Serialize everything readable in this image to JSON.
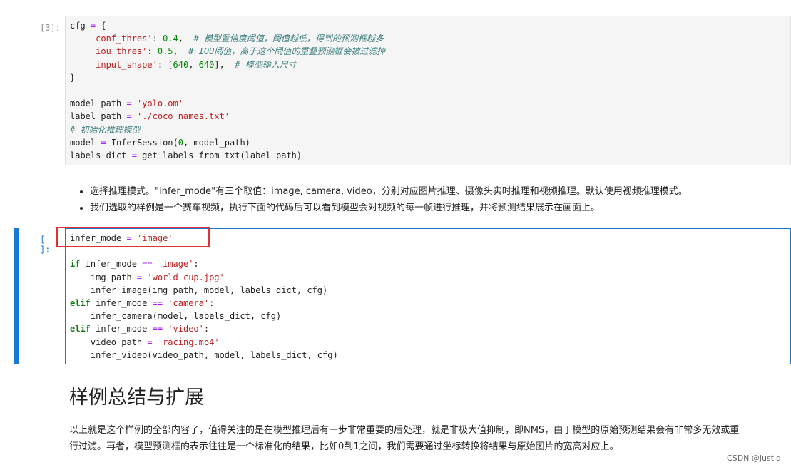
{
  "cell1": {
    "prompt": "[3]:",
    "lines": [
      [
        [
          "p",
          "cfg "
        ],
        [
          "o",
          "="
        ],
        [
          "p",
          " {"
        ]
      ],
      [
        [
          "p",
          "    "
        ],
        [
          "s",
          "'conf_thres'"
        ],
        [
          "p",
          ": "
        ],
        [
          "n",
          "0.4"
        ],
        [
          "p",
          ",  "
        ],
        [
          "c",
          "# 模型置信度阈值，阈值越低，得到的预测框越多"
        ]
      ],
      [
        [
          "p",
          "    "
        ],
        [
          "s",
          "'iou_thres'"
        ],
        [
          "p",
          ": "
        ],
        [
          "n",
          "0.5"
        ],
        [
          "p",
          ",  "
        ],
        [
          "c",
          "# IOU阈值，高于这个阈值的重叠预测框会被过滤掉"
        ]
      ],
      [
        [
          "p",
          "    "
        ],
        [
          "s",
          "'input_shape'"
        ],
        [
          "p",
          ": ["
        ],
        [
          "n",
          "640"
        ],
        [
          "p",
          ", "
        ],
        [
          "n",
          "640"
        ],
        [
          "p",
          "],  "
        ],
        [
          "c",
          "# 模型输入尺寸"
        ]
      ],
      [
        [
          "p",
          "}"
        ]
      ],
      [
        [
          "p",
          ""
        ]
      ],
      [
        [
          "p",
          "model_path "
        ],
        [
          "o",
          "="
        ],
        [
          "p",
          " "
        ],
        [
          "s",
          "'yolo.om'"
        ]
      ],
      [
        [
          "p",
          "label_path "
        ],
        [
          "o",
          "="
        ],
        [
          "p",
          " "
        ],
        [
          "s",
          "'./coco_names.txt'"
        ]
      ],
      [
        [
          "c",
          "# 初始化推理模型"
        ]
      ],
      [
        [
          "p",
          "model "
        ],
        [
          "o",
          "="
        ],
        [
          "p",
          " InferSession("
        ],
        [
          "n",
          "0"
        ],
        [
          "p",
          ", model_path)"
        ]
      ],
      [
        [
          "p",
          "labels_dict "
        ],
        [
          "o",
          "="
        ],
        [
          "p",
          " get_labels_from_txt(label_path)"
        ]
      ]
    ]
  },
  "markdown": {
    "bullets": [
      "选择推理模式。\"infer_mode\"有三个取值：image, camera, video，分别对应图片推理、摄像头实时推理和视频推理。默认使用视频推理模式。",
      "我们选取的样例是一个赛车视频，执行下面的代码后可以看到模型会对视频的每一帧进行推理，并将预测结果展示在画面上。"
    ]
  },
  "cell2": {
    "prompt": "[ ]:",
    "lines": [
      [
        [
          "p",
          "infer_mode "
        ],
        [
          "o",
          "="
        ],
        [
          "p",
          " "
        ],
        [
          "s",
          "'image'"
        ]
      ],
      [
        [
          "p",
          ""
        ]
      ],
      [
        [
          "k",
          "if"
        ],
        [
          "p",
          " infer_mode "
        ],
        [
          "o",
          "=="
        ],
        [
          "p",
          " "
        ],
        [
          "s",
          "'image'"
        ],
        [
          "p",
          ":"
        ]
      ],
      [
        [
          "p",
          "    img_path "
        ],
        [
          "o",
          "="
        ],
        [
          "p",
          " "
        ],
        [
          "s",
          "'world_cup.jpg'"
        ]
      ],
      [
        [
          "p",
          "    infer_image(img_path, model, labels_dict, cfg)"
        ]
      ],
      [
        [
          "k",
          "elif"
        ],
        [
          "p",
          " infer_mode "
        ],
        [
          "o",
          "=="
        ],
        [
          "p",
          " "
        ],
        [
          "s",
          "'camera'"
        ],
        [
          "p",
          ":"
        ]
      ],
      [
        [
          "p",
          "    infer_camera(model, labels_dict, cfg)"
        ]
      ],
      [
        [
          "k",
          "elif"
        ],
        [
          "p",
          " infer_mode "
        ],
        [
          "o",
          "=="
        ],
        [
          "p",
          " "
        ],
        [
          "s",
          "'video'"
        ],
        [
          "p",
          ":"
        ]
      ],
      [
        [
          "p",
          "    video_path "
        ],
        [
          "o",
          "="
        ],
        [
          "p",
          " "
        ],
        [
          "s",
          "'racing.mp4'"
        ]
      ],
      [
        [
          "p",
          "    infer_video(video_path, model, labels_dict, cfg)"
        ]
      ]
    ]
  },
  "heading": "样例总结与扩展",
  "paragraph": [
    "以上就是这个样例的全部内容了，值得关注的是在模型推理后有一步非常重要的后处理，就是非极大值抑制，即NMS，由于模型的原始预测结果会有非常多无效或重",
    "行过滤。再者，模型预测框的表示往往是一个标准化的结果，比如0到1之间，我们需要通过坐标转换将结果与原始图片的宽高对应上。"
  ],
  "watermark": "CSDN @justld",
  "colors": {
    "accent": "#1976d2",
    "highlight_box": "#e03131"
  }
}
